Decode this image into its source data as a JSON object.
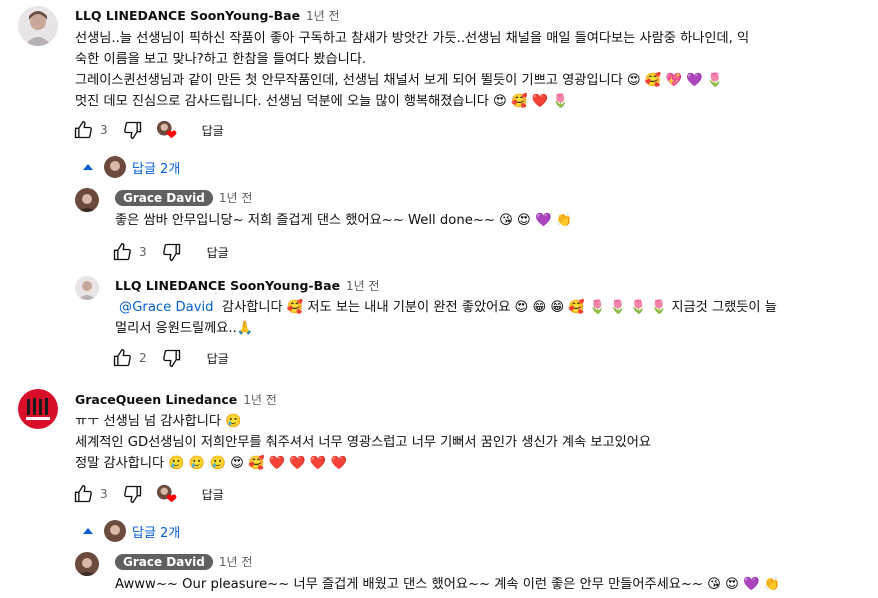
{
  "comments": [
    {
      "author": "LLQ LINEDANCE SoonYoung-Bae",
      "time": "1년 전",
      "lines": [
        "선생님..늘 선생님이 픽하신 작품이 좋아 구독하고 참새가 방앗간 가듯..선생님 채널을 매일 들여다보는 사람중 하나인데, 익",
        "숙한 이름을 보고 맞나?하고 한참을 들여다 봤습니다.",
        "그레이스퀸선생님과 같이 만든 첫 안무작품인데, 선생님 채널서 보게 되어 뛸듯이 기쁘고 영광입니다 😍 🥰 💖 💜 🌷",
        "멋진 데모 진심으로 감사드립니다. 선생님 덕분에 오늘 많이 행복해졌습니다 😍 🥰 ❤️ 🌷"
      ],
      "likes": "3",
      "reply_label": "답글",
      "replies_toggle": "답글 2개"
    },
    {
      "author": "Grace David",
      "time": "1년 전",
      "lines": [
        "좋은 쌈바 안무입니당~ 저희 즐겁게 댄스 했어요~~ Well done~~ 😘 😍 💜 👏"
      ],
      "likes": "3",
      "reply_label": "답글"
    },
    {
      "author": "LLQ LINEDANCE SoonYoung-Bae",
      "time": "1년 전",
      "mention": "@Grace David",
      "lines": [
        "  감사합니다 🥰 저도 보는 내내 기분이 완전 좋았어요 😍 😁 😁 🥰 🌷 🌷 🌷 🌷 지금것 그랬듯이 늘",
        "멀리서 응원드릴께요..🙏"
      ],
      "likes": "2",
      "reply_label": "답글"
    },
    {
      "author": "GraceQueen Linedance",
      "time": "1년 전",
      "lines": [
        "ㅠㅜ 선생님 넘 감사합니다 🥲",
        "세계적인 GD선생님이 저희안무를 춰주셔서 너무 영광스럽고 너무 기뻐서 꿈인가 생신가 계속 보고있어요",
        "정말 감사합니다 🥲 🥲 🥲 😍 🥰 ❤️ ❤️ ❤️ ❤️"
      ],
      "likes": "3",
      "reply_label": "답글",
      "replies_toggle": "답글 2개"
    },
    {
      "author": "Grace David",
      "time": "1년 전",
      "lines": [
        "Awww~~ Our pleasure~~ 너무 즐겁게 배웠고 댄스 했어요~~ 계속 이런 좋은 안무 만들어주세요~~ 😘 😍 💜 👏"
      ]
    }
  ],
  "icons": {
    "like": "thumbs-up-icon",
    "dislike": "thumbs-down-icon",
    "heart": "creator-heart-icon",
    "chevron": "chevron-up-icon"
  },
  "colors": {
    "link": "#065fd4",
    "chip": "#606060",
    "heart": "#ff0000"
  }
}
